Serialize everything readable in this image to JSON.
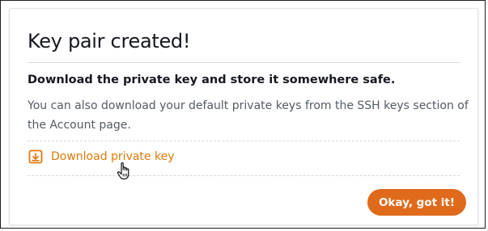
{
  "dialog": {
    "title": "Key pair created!",
    "subheading": "Download the private key and store it somewhere safe.",
    "body": "You can also download your default private keys from the SSH keys section of the Account page.",
    "download_link": {
      "label": "Download private key",
      "icon": "download-icon"
    },
    "confirm_button": {
      "label": "Okay, got it!"
    }
  },
  "colors": {
    "accent": "#e0790b",
    "button_bg": "#e06a1b",
    "title_text": "#16191f",
    "body_text": "#545b64"
  },
  "cursor": {
    "icon": "hand-pointer-icon"
  }
}
